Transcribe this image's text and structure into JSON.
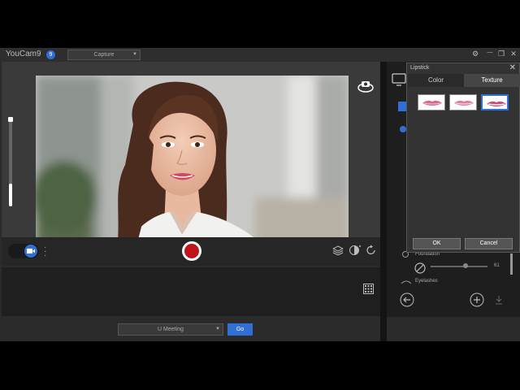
{
  "app": {
    "title": "YouCam9",
    "badge": "9"
  },
  "mode_select": {
    "value": "Capture",
    "caret": "▼"
  },
  "bottom": {
    "meeting_select": "U Meeting",
    "caret": "▼",
    "go_label": "Go"
  },
  "window": {
    "settings": "⚙",
    "minimize": "—",
    "maximize": "❐",
    "close": "✕"
  },
  "lipstick_dialog": {
    "title": "Lipstick",
    "close": "✕",
    "tabs": [
      {
        "label": "Color"
      },
      {
        "label": "Texture"
      }
    ],
    "ok_label": "OK",
    "cancel_label": "Cancel"
  },
  "right_panel": {
    "foundation_label": "Foundation",
    "foundation_value": "61",
    "eyelashes_label": "Eyelashes"
  },
  "colors": {
    "accent": "#2f6fd6",
    "record": "#c0141c"
  }
}
